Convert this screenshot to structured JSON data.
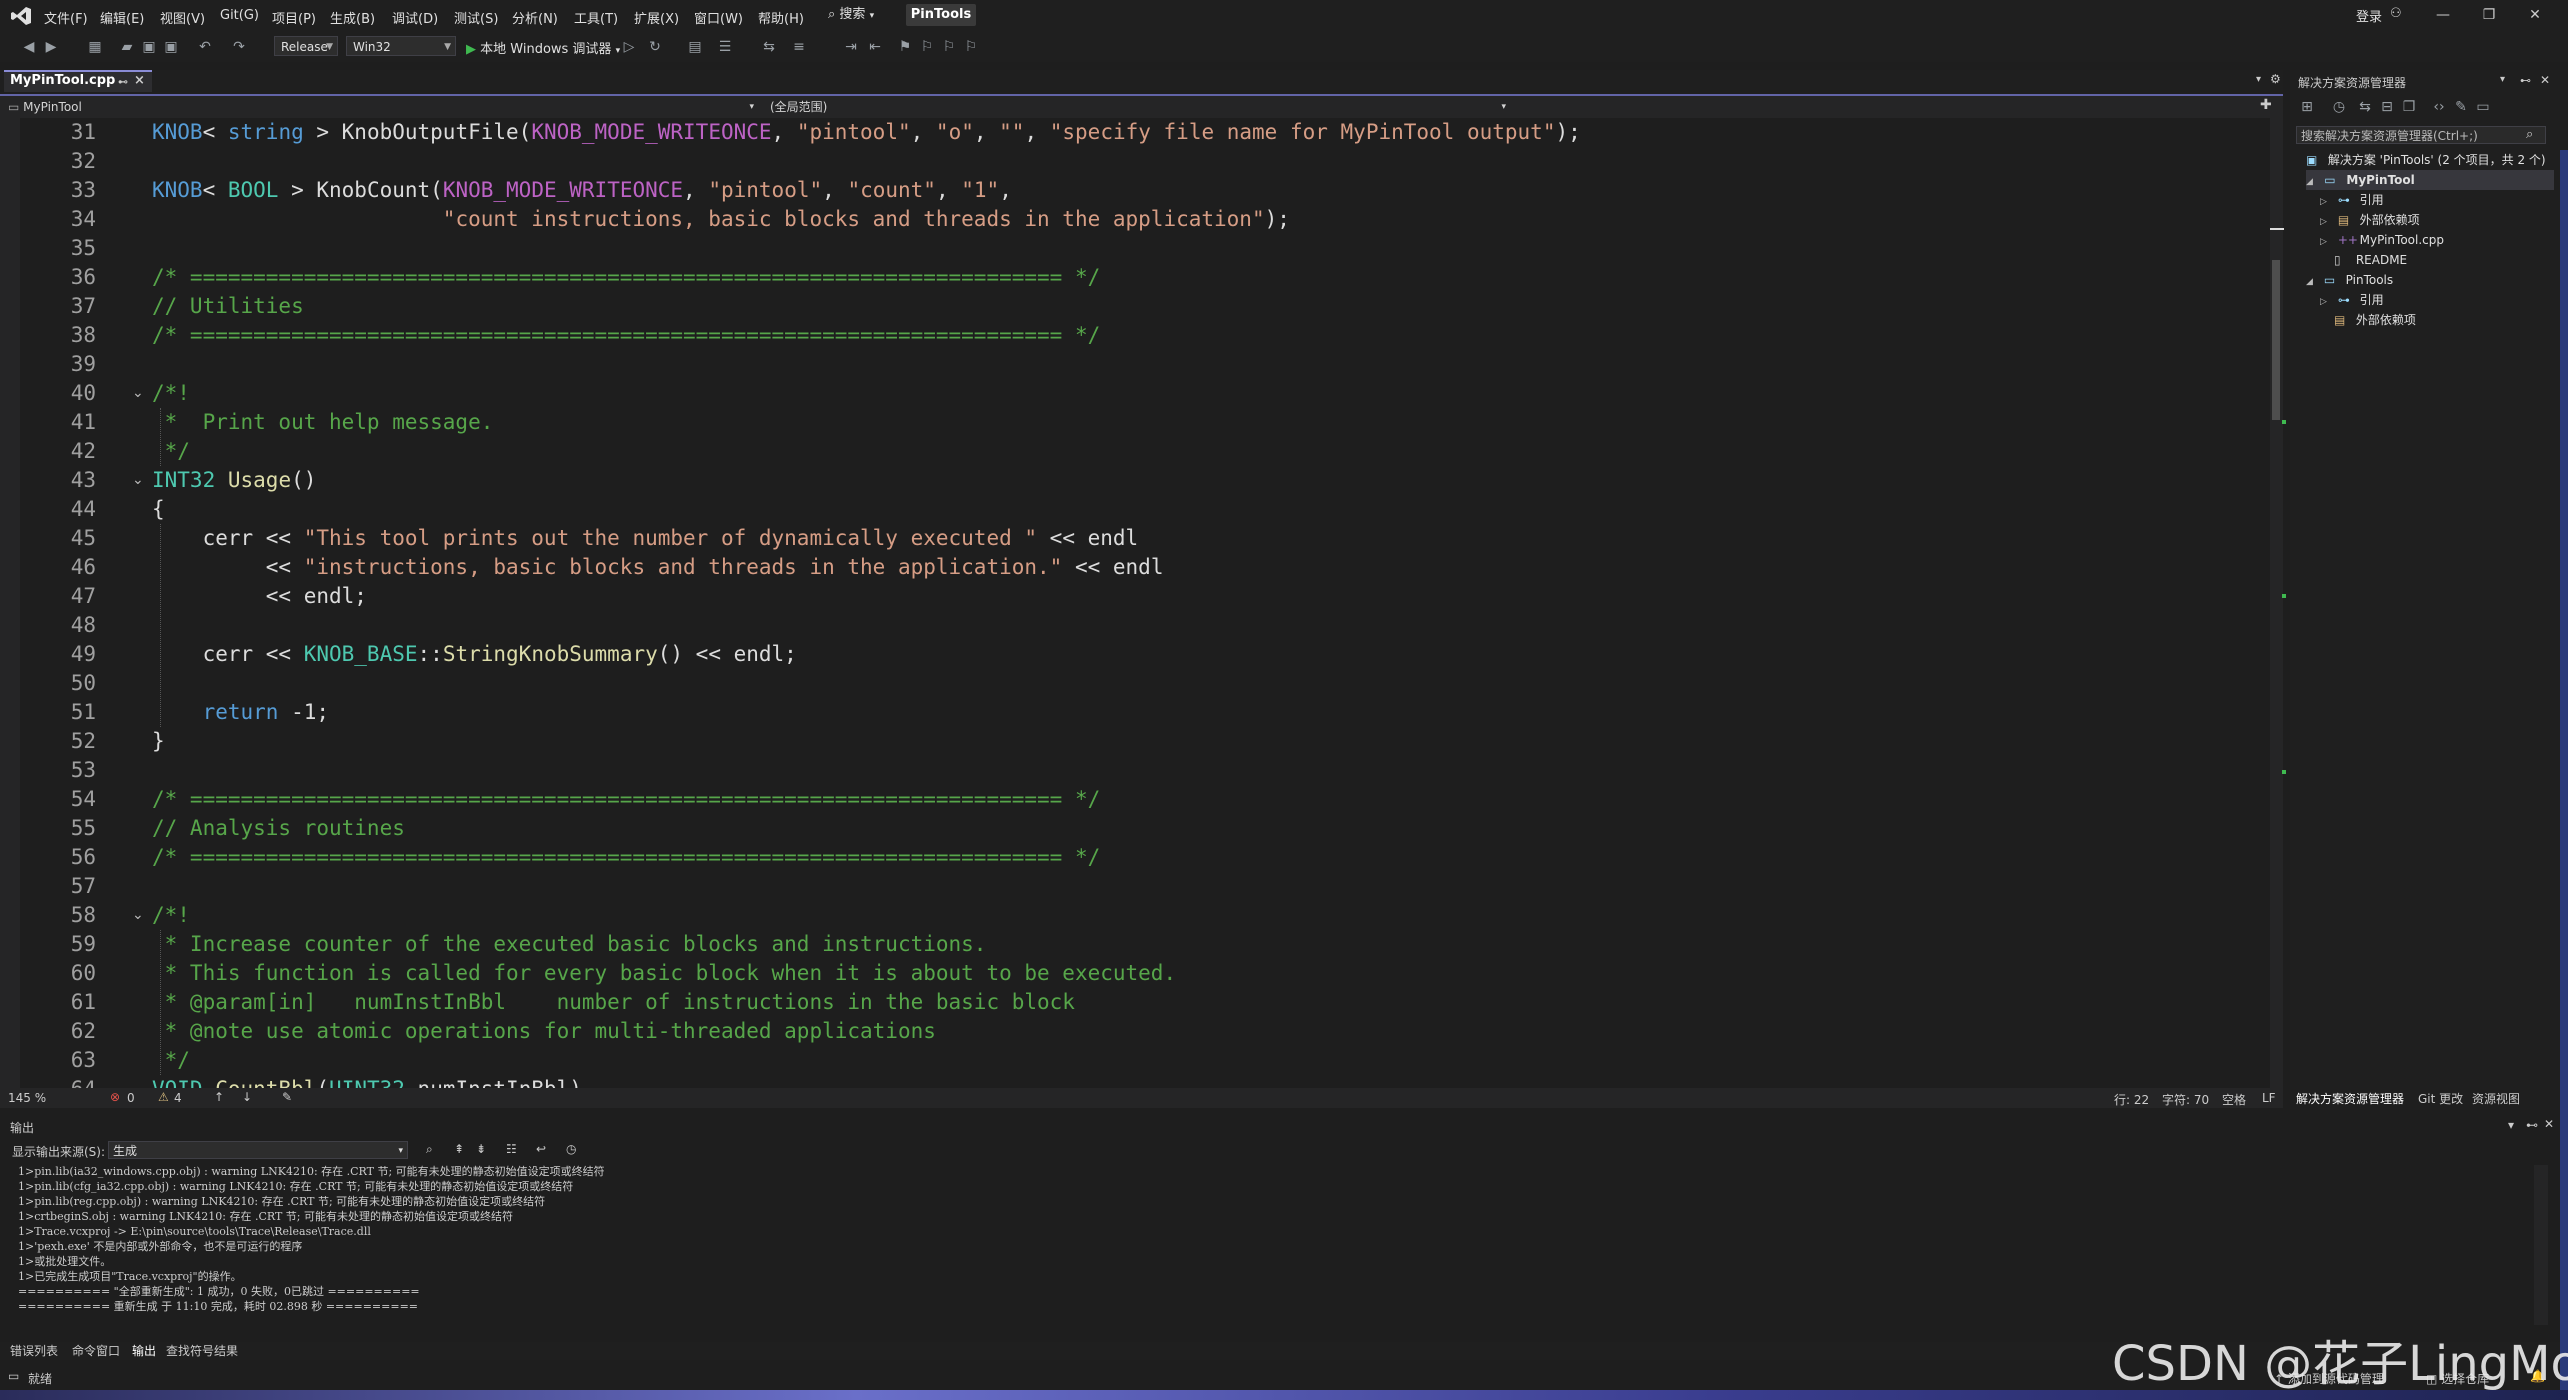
{
  "menubar": {
    "items": [
      "文件(F)",
      "编辑(E)",
      "视图(V)",
      "Git(G)",
      "项目(P)",
      "生成(B)",
      "调试(D)",
      "测试(S)",
      "分析(N)",
      "工具(T)",
      "扩展(X)",
      "窗口(W)",
      "帮助(H)"
    ],
    "search": "搜索",
    "solution_name": "PinTools",
    "login": "登录"
  },
  "toolbar": {
    "configuration": "Release",
    "platform": "Win32",
    "debugger": "本地 Windows 调试器"
  },
  "doc_tab": {
    "label": "MyPinTool.cpp"
  },
  "navbar": {
    "project": "MyPinTool",
    "scope": "(全局范围)"
  },
  "editor": {
    "line_numbers": [
      "31",
      "32",
      "33",
      "34",
      "35",
      "36",
      "37",
      "38",
      "39",
      "40",
      "41",
      "42",
      "43",
      "44",
      "45",
      "46",
      "47",
      "48",
      "49",
      "50",
      "51",
      "52",
      "53",
      "54",
      "55",
      "56",
      "57",
      "58",
      "59",
      "60",
      "61",
      "62",
      "63",
      "64"
    ]
  },
  "editor_status": {
    "zoom": "145 %",
    "errors": "0",
    "warnings": "4",
    "line": "行: 22",
    "char": "字符: 70",
    "spacing": "空格",
    "eol": "LF"
  },
  "output": {
    "title": "输出",
    "source_label": "显示输出来源(S):",
    "source_value": "生成",
    "lines": [
      "1>pin.lib(ia32_windows.cpp.obj) : warning LNK4210: 存在 .CRT 节; 可能有未处理的静态初始值设定项或终结符",
      "1>pin.lib(cfg_ia32.cpp.obj) : warning LNK4210: 存在 .CRT 节; 可能有未处理的静态初始值设定项或终结符",
      "1>pin.lib(reg.cpp.obj) : warning LNK4210: 存在 .CRT 节; 可能有未处理的静态初始值设定项或终结符",
      "1>crtbeginS.obj : warning LNK4210: 存在 .CRT 节; 可能有未处理的静态初始值设定项或终结符",
      "1>Trace.vcxproj -> E:\\pin\\source\\tools\\Trace\\Release\\Trace.dll",
      "1>'pexh.exe' 不是内部或外部命令，也不是可运行的程序",
      "1>或批处理文件。",
      "1>已完成生成项目\"Trace.vcxproj\"的操作。",
      "========== \"全部重新生成\": 1 成功，0 失败，0已跳过 ==========",
      "========== 重新生成 于 11:10 完成，耗时 02.898 秒 =========="
    ]
  },
  "bottom_tabs": [
    "错误列表",
    "命令窗口",
    "输出",
    "查找符号结果"
  ],
  "statusbar": {
    "ready": "就绪",
    "source_control": "添加到源代码管理",
    "repo": "选择仓库"
  },
  "solution_explorer": {
    "title": "解决方案资源管理器",
    "search_placeholder": "搜索解决方案资源管理器(Ctrl+;)",
    "solution_root": "解决方案 'PinTools' (2 个项目，共 2 个)",
    "tree": [
      {
        "label": "MyPinTool",
        "level": 1,
        "expanded": true,
        "bold": true
      },
      {
        "label": "引用",
        "level": 2,
        "expanded": false
      },
      {
        "label": "外部依赖项",
        "level": 2,
        "expanded": false
      },
      {
        "label": "MyPinTool.cpp",
        "level": 2,
        "expanded": false
      },
      {
        "label": "README",
        "level": 2,
        "expanded": null
      },
      {
        "label": "PinTools",
        "level": 1,
        "expanded": true
      },
      {
        "label": "引用",
        "level": 2,
        "expanded": false
      },
      {
        "label": "外部依赖项",
        "level": 2,
        "expanded": null
      }
    ],
    "tabs": [
      "解决方案资源管理器",
      "Git 更改",
      "资源视图"
    ]
  },
  "watermark": "CSDN @花子LingMo",
  "colors": {
    "accent": "#6264a7",
    "keyword": "#569cd6",
    "type": "#4ec9b0",
    "string": "#d69d85",
    "comment": "#57a64a",
    "macro": "#bd63c5"
  }
}
